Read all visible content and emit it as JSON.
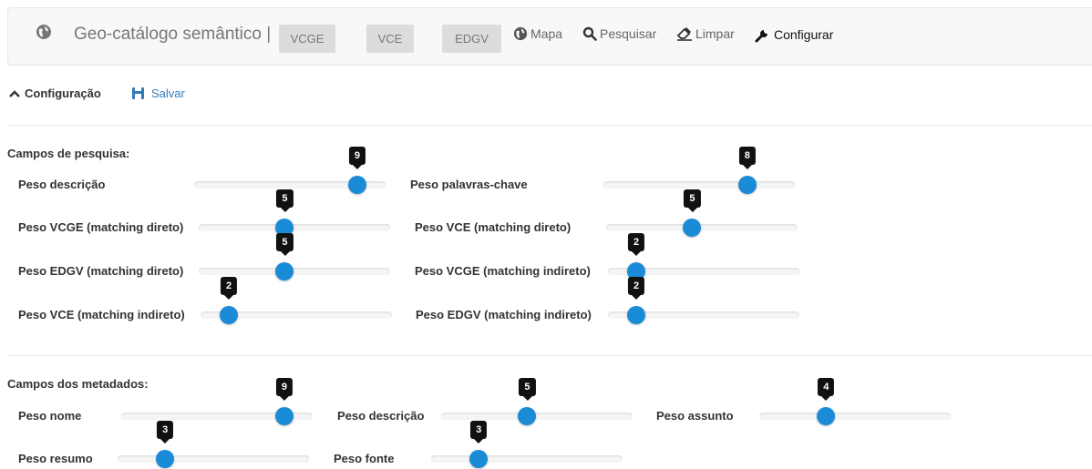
{
  "navbar": {
    "brand": "Geo-catálogo semântico |",
    "buttons": [
      "VCGE",
      "VCE",
      "EDGV"
    ],
    "links": [
      {
        "label": "Mapa",
        "icon": "globe-icon"
      },
      {
        "label": "Pesquisar",
        "icon": "search-icon"
      },
      {
        "label": "Limpar",
        "icon": "eraser-icon"
      },
      {
        "label": "Configurar",
        "icon": "wrench-icon"
      }
    ]
  },
  "config": {
    "title": "Configuração",
    "save_label": "Salvar",
    "colors": {
      "accent": "#337ab7",
      "handle": "#1a8bd6",
      "tooltip": "#111111"
    }
  },
  "search_fields": {
    "title": "Campos de pesquisa:",
    "sliders": [
      {
        "label": "Peso descrição",
        "value": 9
      },
      {
        "label": "Peso palavras-chave",
        "value": 8
      },
      {
        "label": "Peso VCGE (matching direto)",
        "value": 5
      },
      {
        "label": "Peso VCE (matching direto)",
        "value": 5
      },
      {
        "label": "Peso EDGV (matching direto)",
        "value": 5
      },
      {
        "label": "Peso VCGE (matching indireto)",
        "value": 2
      },
      {
        "label": "Peso VCE (matching indireto)",
        "value": 2
      },
      {
        "label": "Peso EDGV (matching indireto)",
        "value": 2
      }
    ]
  },
  "metadata_fields": {
    "title": "Campos dos metadados:",
    "sliders": [
      {
        "label": "Peso nome",
        "value": 9
      },
      {
        "label": "Peso descrição",
        "value": 5
      },
      {
        "label": "Peso assunto",
        "value": 4
      },
      {
        "label": "Peso resumo",
        "value": 3
      },
      {
        "label": "Peso fonte",
        "value": 3
      }
    ]
  },
  "slider_range": {
    "min": 1,
    "max": 10
  }
}
